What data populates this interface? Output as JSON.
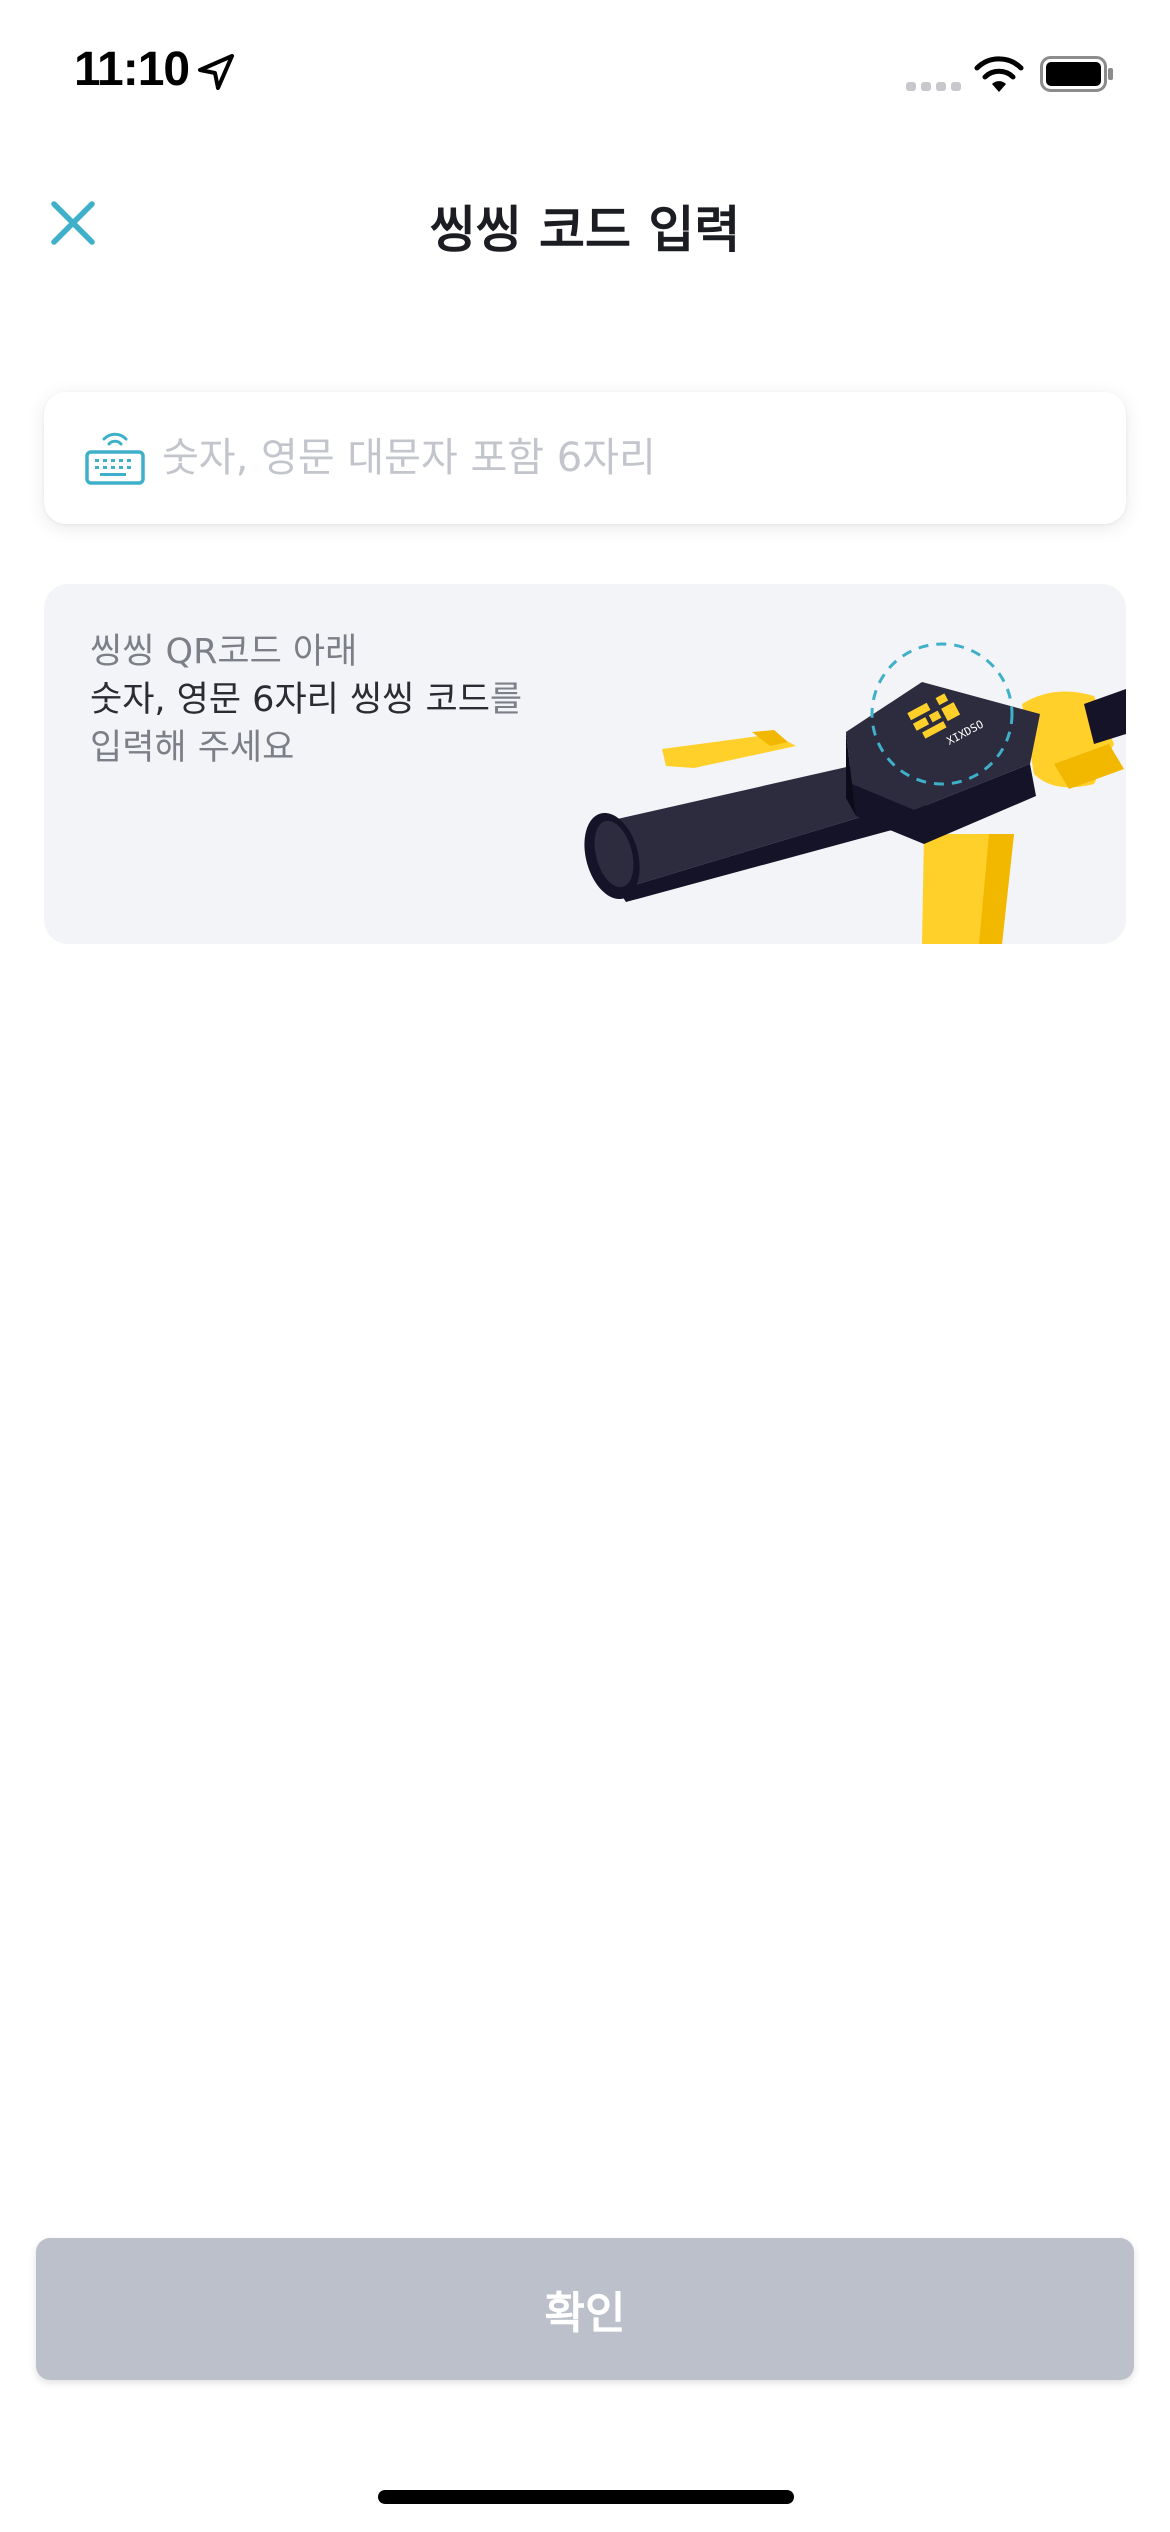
{
  "status_bar": {
    "time": "11:10",
    "icons": [
      "location-arrow-icon",
      "signal-icon",
      "wifi-icon",
      "battery-icon"
    ]
  },
  "header": {
    "title": "씽씽 코드 입력",
    "close_icon": "close-icon"
  },
  "code_input": {
    "value": "",
    "placeholder": "숫자, 영문 대문자 포함 6자리",
    "icon": "keyboard-icon"
  },
  "guide": {
    "line1": "씽씽 QR코드 아래",
    "line2_strong": "숫자, 영문 6자리 씽씽 코드",
    "line2_tail": "를",
    "line3": "입력해 주세요",
    "sticker_code": "XIXDSO"
  },
  "confirm_button": {
    "label": "확인"
  },
  "colors": {
    "accent": "#3fb0c9",
    "button_disabled": "#bbc0ca",
    "card_bg": "#f3f4f7",
    "scooter_yellow": "#ffcf2a",
    "scooter_dark": "#141327"
  }
}
